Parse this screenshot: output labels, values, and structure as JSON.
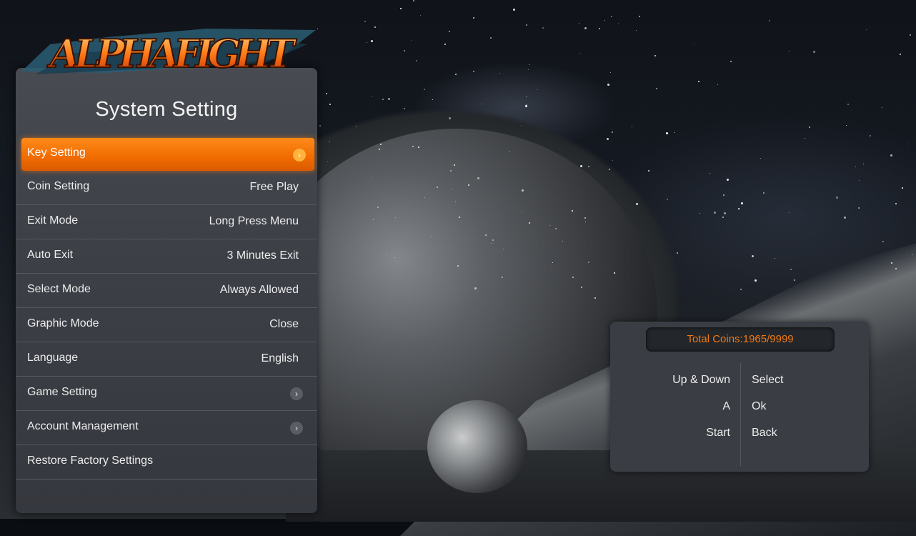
{
  "logo": {
    "text": "ALPHAFIGHT"
  },
  "panel": {
    "title": "System Setting",
    "items": [
      {
        "label": "Key Setting",
        "value": "",
        "arrow": true,
        "selected": true
      },
      {
        "label": "Coin Setting",
        "value": "Free Play",
        "arrow": false,
        "selected": false
      },
      {
        "label": "Exit Mode",
        "value": "Long Press Menu",
        "arrow": false,
        "selected": false
      },
      {
        "label": "Auto Exit",
        "value": "3 Minutes Exit",
        "arrow": false,
        "selected": false
      },
      {
        "label": "Select Mode",
        "value": "Always Allowed",
        "arrow": false,
        "selected": false
      },
      {
        "label": "Graphic Mode",
        "value": "Close",
        "arrow": false,
        "selected": false
      },
      {
        "label": "Language",
        "value": "English",
        "arrow": false,
        "selected": false
      },
      {
        "label": "Game Setting",
        "value": "",
        "arrow": true,
        "selected": false
      },
      {
        "label": "Account Management",
        "value": "",
        "arrow": true,
        "selected": false
      },
      {
        "label": "Restore Factory Settings",
        "value": "",
        "arrow": false,
        "selected": false
      }
    ]
  },
  "info": {
    "total_coins": "Total Coins:1965/9999",
    "keys": [
      {
        "button": "Up & Down",
        "action": "Select"
      },
      {
        "button": "A",
        "action": "Ok"
      },
      {
        "button": "Start",
        "action": "Back"
      }
    ]
  },
  "colors": {
    "accent": "#f07a14",
    "panel_bg": "#3d4047",
    "text": "#ececec"
  },
  "icons": {
    "row_arrow": "chevron-right-icon"
  }
}
